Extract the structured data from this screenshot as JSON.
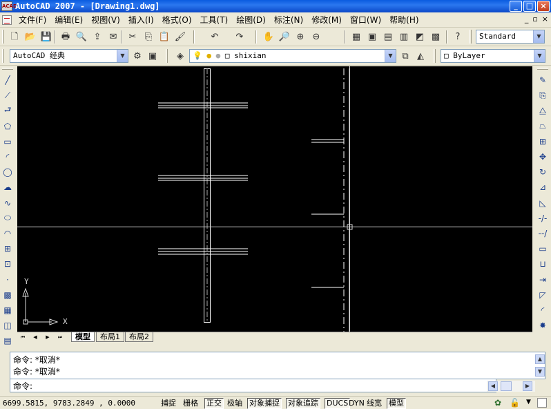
{
  "window": {
    "title": "AutoCAD 2007 - [Drawing1.dwg]",
    "app_icon_text": "ACAD",
    "buttons": [
      "_",
      "□",
      "×"
    ]
  },
  "menu": {
    "items": [
      "文件(F)",
      "编辑(E)",
      "视图(V)",
      "插入(I)",
      "格式(O)",
      "工具(T)",
      "绘图(D)",
      "标注(N)",
      "修改(M)",
      "窗口(W)",
      "帮助(H)"
    ],
    "mdi_buttons": [
      "_",
      "▫",
      "×"
    ]
  },
  "toolbar_standard": {
    "text_style": "Standard",
    "icons": [
      "new-icon",
      "open-icon",
      "save-icon",
      "print-icon",
      "preview-icon",
      "publish-icon",
      "plot-icon",
      "cut-icon",
      "copy-icon",
      "paste-icon",
      "matchprop-icon",
      "undo-icon",
      "redo-icon",
      "pan-icon",
      "zoom-realtime-icon",
      "zoom-window-icon",
      "zoom-previous-icon",
      "properties-icon",
      "designcenter-icon",
      "toolpalettes-icon",
      "sheetset-icon",
      "markup-icon",
      "calculator-icon",
      "help-icon"
    ],
    "glyphs": [
      "🗋",
      "📂",
      "💾",
      "🖶",
      "🔍",
      "⇪",
      "✉",
      "✂",
      "⎘",
      "📋",
      "🖌",
      "↶",
      "↷",
      "✋",
      "🔎",
      "⊕",
      "⊖",
      "▦",
      "▣",
      "▤",
      "▥",
      "◩",
      "▩",
      "?"
    ]
  },
  "toolbar_workspace": {
    "workspace": "AutoCAD 经典",
    "layer": "shixian",
    "color": "ByLayer"
  },
  "draw_tools": {
    "icons": [
      "line-icon",
      "construction-line-icon",
      "polyline-icon",
      "polygon-icon",
      "rectangle-icon",
      "arc-icon",
      "circle-icon",
      "revision-cloud-icon",
      "spline-icon",
      "ellipse-icon",
      "ellipse-arc-icon",
      "insert-block-icon",
      "make-block-icon",
      "point-icon",
      "hatch-icon",
      "gradient-icon",
      "region-icon",
      "table-icon"
    ],
    "glyphs": [
      "╱",
      "⟋",
      "⮐",
      "⬠",
      "▭",
      "◜",
      "◯",
      "☁",
      "∿",
      "⬭",
      "◠",
      "⊞",
      "⊡",
      "·",
      "▩",
      "▦",
      "◫",
      "▤"
    ]
  },
  "modify_tools": {
    "icons": [
      "erase-icon",
      "copy-object-icon",
      "mirror-icon",
      "offset-icon",
      "array-icon",
      "move-icon",
      "rotate-icon",
      "scale-icon",
      "stretch-icon",
      "trim-icon",
      "extend-icon",
      "break-at-point-icon",
      "break-icon",
      "join-icon",
      "chamfer-icon",
      "fillet-icon",
      "explode-icon"
    ],
    "glyphs": [
      "✎",
      "⎘",
      "⧋",
      "⏢",
      "⊞",
      "✥",
      "↻",
      "⊿",
      "◺",
      "-/-",
      "--/",
      "▭",
      "⊔",
      "⇥",
      "◸",
      "◜",
      "✸"
    ]
  },
  "canvas": {
    "ucs": {
      "x_label": "X",
      "y_label": "Y"
    }
  },
  "layout_tabs": {
    "nav": [
      "⏮",
      "◀",
      "▶",
      "⏭"
    ],
    "tabs": [
      "模型",
      "布局1",
      "布局2"
    ],
    "active": 0
  },
  "command": {
    "lines": [
      "命令: *取消*",
      "命令: *取消*"
    ],
    "prompt": "命令:"
  },
  "status": {
    "coordinates": "6699.5815,  9783.2849 , 0.0000",
    "toggles": [
      {
        "label": "捕捉",
        "on": false
      },
      {
        "label": "栅格",
        "on": false
      },
      {
        "label": "正交",
        "on": true
      },
      {
        "label": "极轴",
        "on": false
      },
      {
        "label": "对象捕捉",
        "on": true
      },
      {
        "label": "对象追踪",
        "on": true
      },
      {
        "label": "DUCS",
        "on": true
      },
      {
        "label": "DYN",
        "on": false
      },
      {
        "label": "线宽",
        "on": false
      },
      {
        "label": "模型",
        "on": true
      }
    ]
  }
}
